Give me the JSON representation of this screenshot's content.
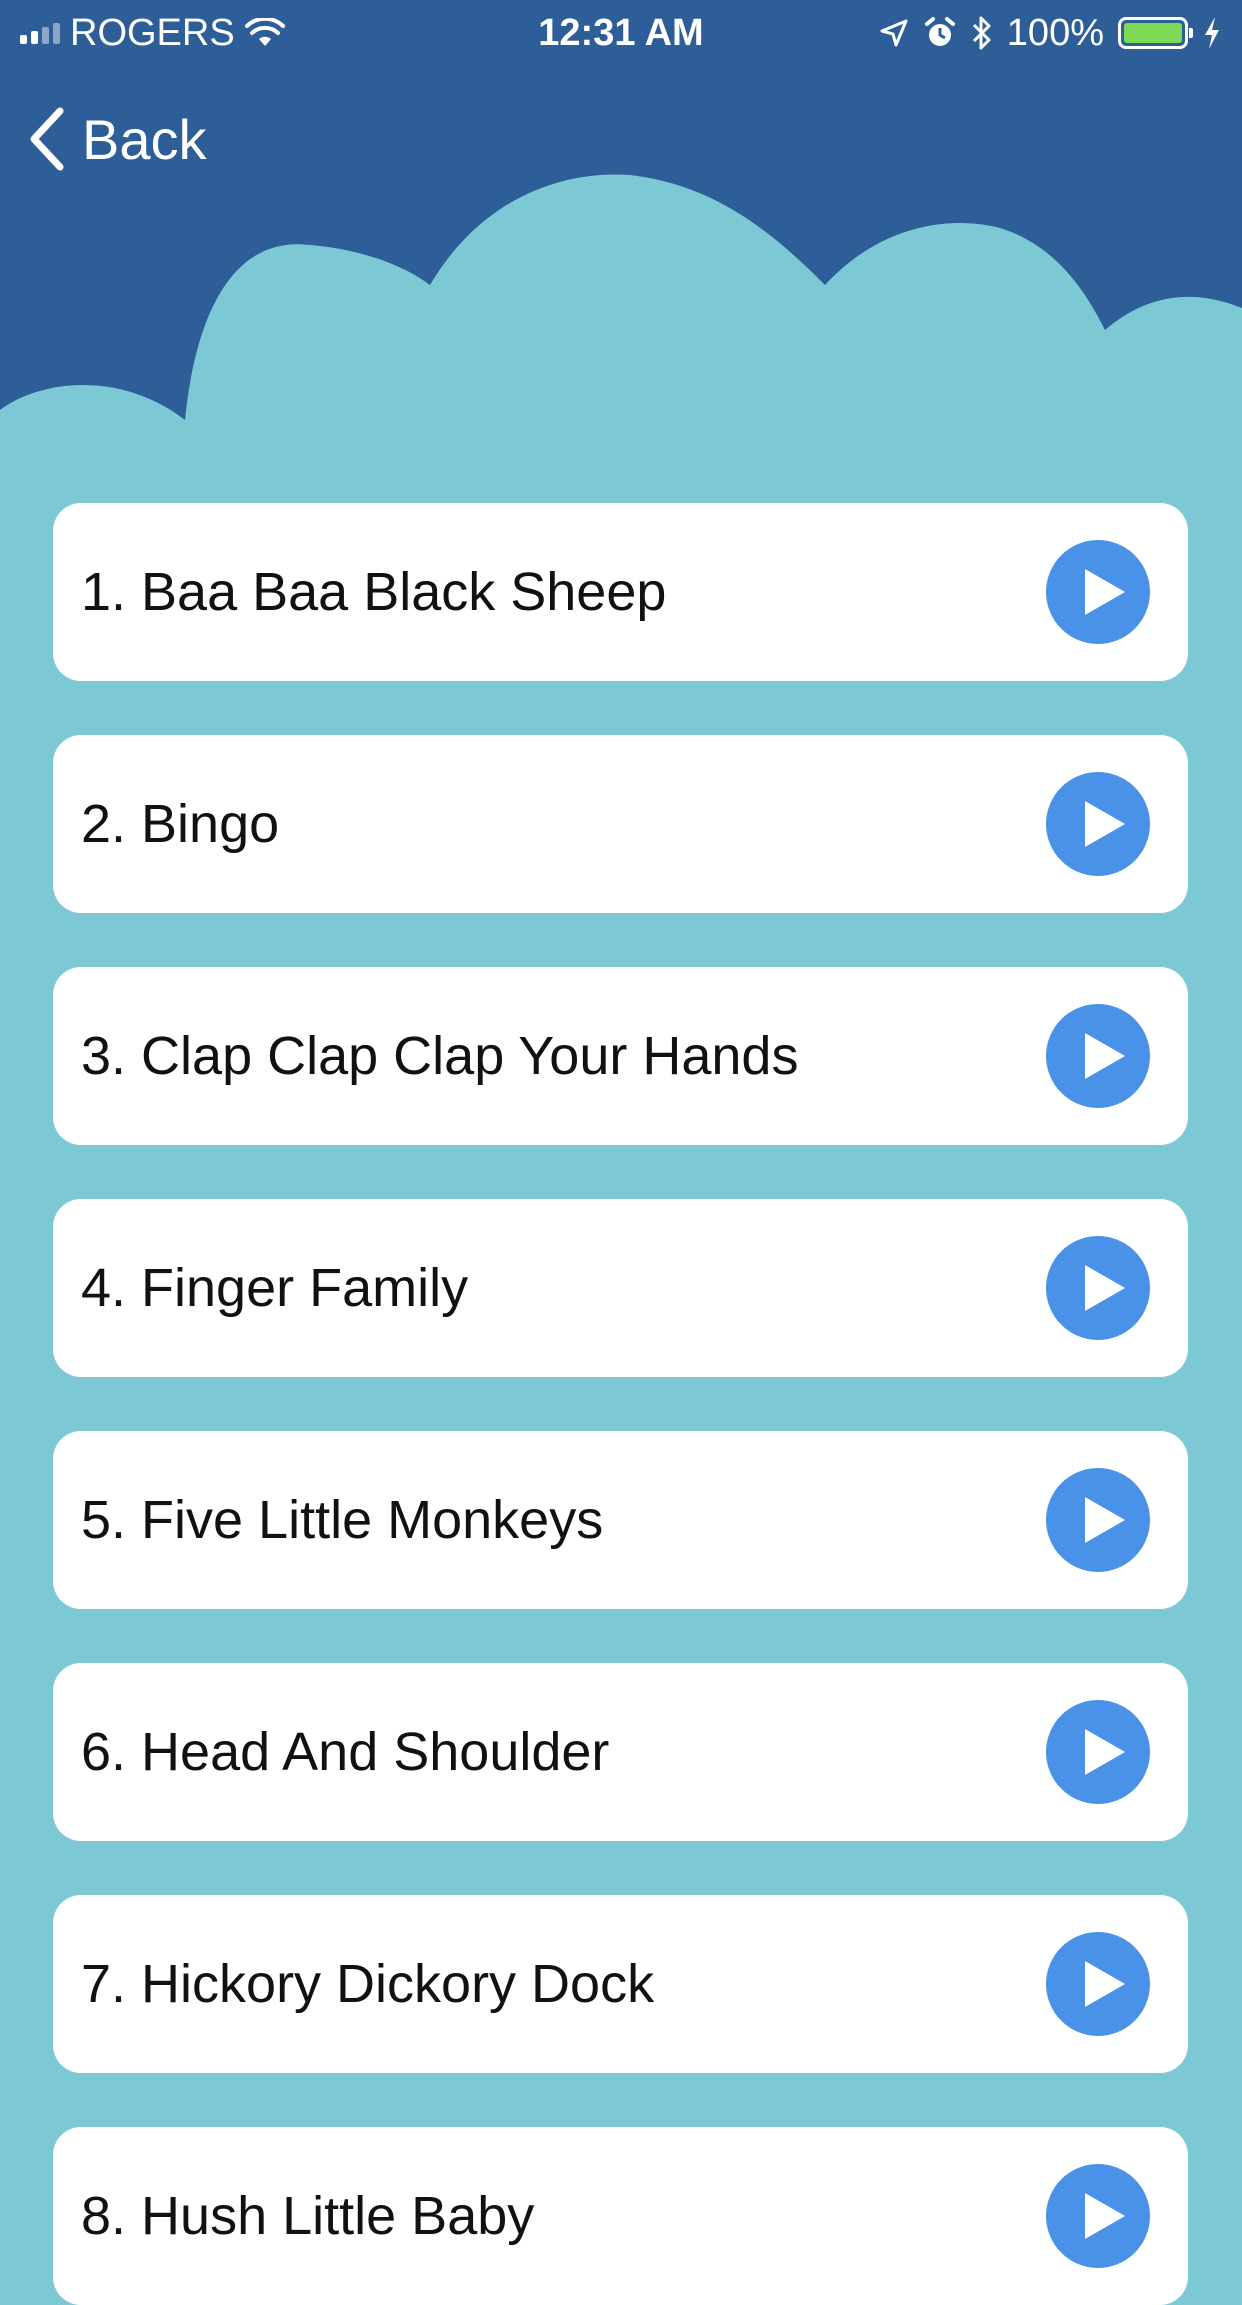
{
  "colors": {
    "header_dark": "#2d5e98",
    "cloud": "#7cc8d5",
    "card": "#ffffff",
    "play_button": "#4a92e8",
    "battery": "#7ed957"
  },
  "status_bar": {
    "carrier": "ROGERS",
    "time": "12:31 AM",
    "battery_percent": "100%",
    "icons": [
      "signal-icon",
      "wifi-icon",
      "location-icon",
      "alarm-icon",
      "bluetooth-icon",
      "battery-icon",
      "charging-icon"
    ]
  },
  "nav": {
    "back_label": "Back",
    "back_icon": "chevron-left-icon"
  },
  "songs": [
    {
      "title": "1. Baa Baa Black Sheep",
      "icon": "play-icon"
    },
    {
      "title": "2. Bingo",
      "icon": "play-icon"
    },
    {
      "title": "3. Clap Clap Clap Your Hands",
      "icon": "play-icon"
    },
    {
      "title": "4. Finger Family",
      "icon": "play-icon"
    },
    {
      "title": "5. Five Little Monkeys",
      "icon": "play-icon"
    },
    {
      "title": "6. Head And Shoulder",
      "icon": "play-icon"
    },
    {
      "title": "7. Hickory Dickory Dock",
      "icon": "play-icon"
    },
    {
      "title": "8. Hush Little Baby",
      "icon": "play-icon"
    }
  ]
}
